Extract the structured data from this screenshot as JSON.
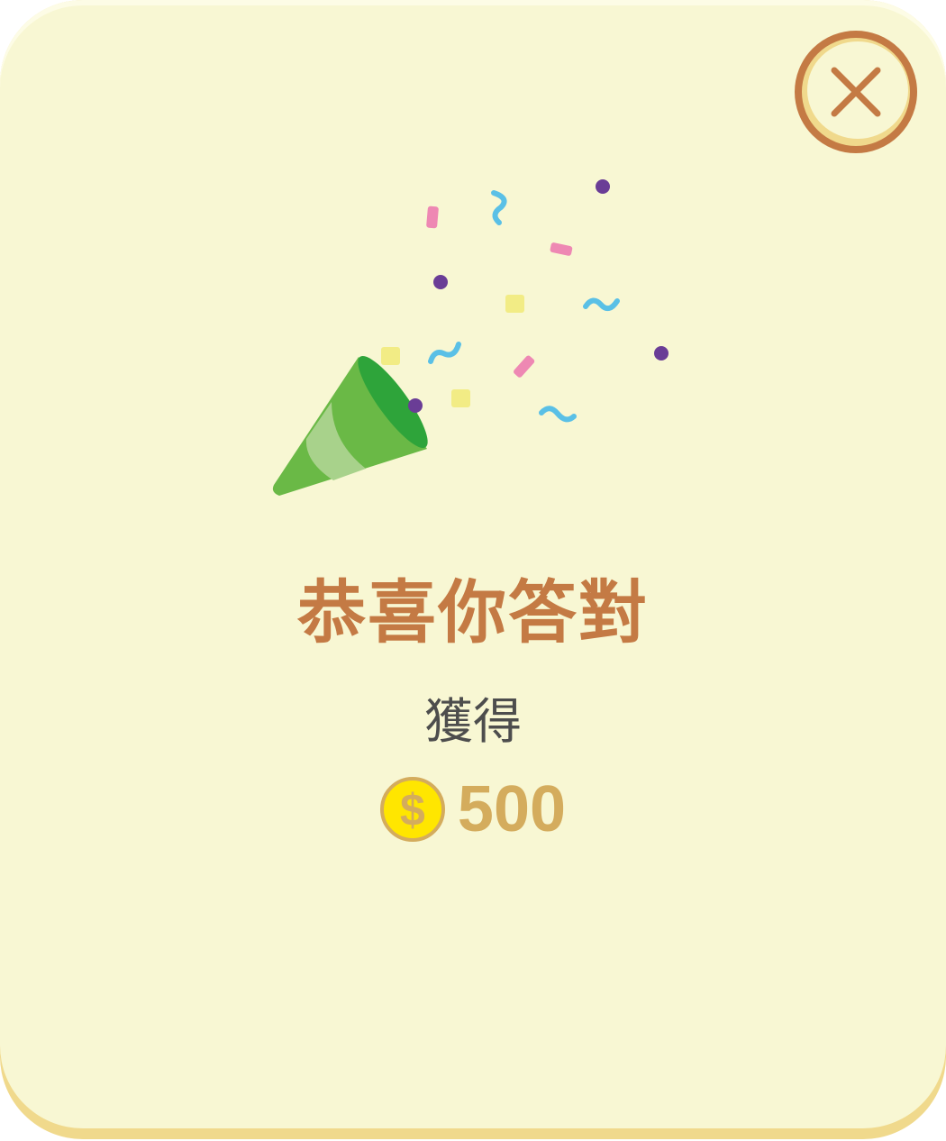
{
  "dialog": {
    "title": "恭喜你答對",
    "subtitle": "獲得",
    "reward": {
      "currency_icon": "dollar-coin-icon",
      "currency_symbol": "$",
      "amount": "500"
    },
    "close_icon": "close-icon",
    "illustration_icon": "party-popper-icon"
  },
  "colors": {
    "card_background": "#f8f7d3",
    "card_shadow": "#f0d98c",
    "accent_brown": "#c47a44",
    "coin_yellow": "#ffe600",
    "coin_gold": "#d4ac5d",
    "text_dark": "#4d4d4d",
    "popper_green": "#6ab946",
    "confetti_pink": "#ee88b3",
    "confetti_blue": "#5ac0e6",
    "confetti_purple": "#6a3d96",
    "confetti_yellow": "#f2ec85"
  }
}
